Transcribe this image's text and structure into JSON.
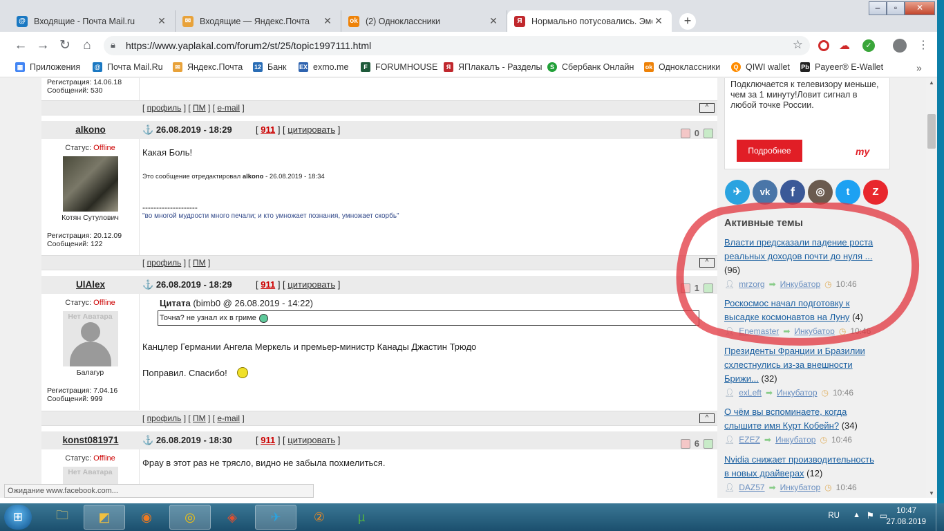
{
  "tabs": [
    {
      "title": "Входящие - Почта Mail.ru",
      "icon": "mailru-icon",
      "color": "#1a78c2",
      "glyph": "@"
    },
    {
      "title": "Входящие — Яндекс.Почта",
      "icon": "yandex-mail-icon",
      "color": "#e8a23a",
      "glyph": "✉"
    },
    {
      "title": "(2) Одноклассники",
      "icon": "ok-icon",
      "color": "#ee8208",
      "glyph": "ok"
    },
    {
      "title": "Нормально потусовались. Эмоц",
      "icon": "yaplakal-icon",
      "color": "#c0282d",
      "glyph": "Я"
    }
  ],
  "toolbar": {
    "url": "https://www.yaplakal.com/forum2/st/25/topic1997111.html"
  },
  "bookmarks": [
    {
      "label": "Приложения",
      "color": "#4285f4",
      "glyph": "▦"
    },
    {
      "label": "Почта Mail.Ru",
      "color": "#1a78c2",
      "glyph": "@"
    },
    {
      "label": "Яндекс.Почта",
      "color": "#e8a23a",
      "glyph": "✉"
    },
    {
      "label": "Банк",
      "color": "#2a6db5",
      "glyph": "12"
    },
    {
      "label": "exmo.me",
      "color": "#2f64b0",
      "glyph": "EX"
    },
    {
      "label": "FORUMHOUSE",
      "color": "#1e5a3a",
      "glyph": "F"
    },
    {
      "label": "ЯПлакалъ - Разделы",
      "color": "#c0282d",
      "glyph": "Я"
    },
    {
      "label": "Сбербанк Онлайн",
      "color": "#21a038",
      "glyph": "S"
    },
    {
      "label": "Одноклассники",
      "color": "#ee8208",
      "glyph": "ok"
    },
    {
      "label": "QIWI wallet",
      "color": "#ff8c00",
      "glyph": "Q"
    },
    {
      "label": "Payeer® E-Wallet",
      "color": "#222222",
      "glyph": "Pb"
    }
  ],
  "forum": {
    "top_reg": "Регистрация: 14.06.18",
    "top_msgs": "Сообщений: 530",
    "profile": "профиль",
    "pm": "ПМ",
    "email": "e-mail",
    "up": "[^]",
    "status_label": "Статус:",
    "offline": "Offline",
    "quote_word": "цитировать",
    "posts": [
      {
        "author": "alkono",
        "date": "26.08.2019 - 18:29",
        "rating": "911",
        "karma": "0",
        "nick": "Котян Сутулович",
        "reg": "Регистрация: 20.12.09",
        "msgs": "Сообщений: 122",
        "text": "Какая Боль!",
        "edit_prefix": "Это сообщение отредактировал",
        "edit_author": "alkono",
        "edit_date": " - 26.08.2019 - 18:34",
        "sig_line": "--------------------",
        "signature": "\"во многой мудрости много печали; и кто умножает познания, умножает скорбь\""
      },
      {
        "author": "UlAlex",
        "date": "26.08.2019 - 18:29",
        "rating": "911",
        "karma": "1",
        "no_avatar": "Нет Аватара",
        "nick": "Балагур",
        "reg": "Регистрация: 7.04.16",
        "msgs": "Сообщений: 999",
        "quote_label": "Цитата",
        "quote_src": "(bimb0 @ 26.08.2019 - 14:22)",
        "quote_text": "Точна? не узнал их в гриме",
        "text1": "Канцлер Германии Ангела Меркель и премьер-министр Канады Джастин Трюдо",
        "text2": "Поправил. Спасибо!"
      },
      {
        "author": "konst081971",
        "date": "26.08.2019 - 18:30",
        "rating": "911",
        "karma": "6",
        "no_avatar": "Нет Аватара",
        "text": "Фрау в этот раз не трясло, видно не забыла похмелиться."
      }
    ]
  },
  "ad": {
    "text": "Подключается к телевизору меньше, чем за 1 минуту!Ловит сигнал в любой точке России.",
    "button": "Подробнее",
    "brand": "my"
  },
  "social": [
    {
      "name": "telegram-icon",
      "color": "#2aa3e0",
      "glyph": "✈"
    },
    {
      "name": "vk-icon",
      "color": "#4a76a8",
      "glyph": "vk"
    },
    {
      "name": "facebook-icon",
      "color": "#3b5998",
      "glyph": "f"
    },
    {
      "name": "instagram-icon",
      "color": "#6b5b4f",
      "glyph": "◎"
    },
    {
      "name": "twitter-icon",
      "color": "#1da1f2",
      "glyph": "t"
    },
    {
      "name": "zen-icon",
      "color": "#e8272d",
      "glyph": "Z"
    }
  ],
  "active": {
    "title": "Активные темы",
    "topics": [
      {
        "l1": "Власти предсказали падение роста",
        "l2": "реальных доходов почти до нуля ...",
        "count": "(96)",
        "user": "mrzorg",
        "section": "Инкубатор",
        "time": "10:46"
      },
      {
        "l1": "Роскосмос начал подготовку к",
        "l2": "высадке космонавтов на Луну",
        "count": "(4)",
        "user": "Enemaster",
        "section": "Инкубатор",
        "time": "10:46"
      },
      {
        "l1": "Президенты Франции и Бразилии",
        "l2": "схлестнулись из-за внешности",
        "l3": "Брижи...",
        "count": "(32)",
        "user": "exLeft",
        "section": "Инкубатор",
        "time": "10:46"
      },
      {
        "l1": "О чём вы вспоминаете, когда",
        "l2": "слышите имя Курт Кобейн?",
        "count": "(34)",
        "user": "EZEZ",
        "section": "Инкубатор",
        "time": "10:46"
      },
      {
        "l1": "Nvidia снижает производительность",
        "l2": "в новых драйверах",
        "count": "(12)",
        "user": "DAZ57",
        "section": "Инкубатор",
        "time": "10:46"
      }
    ]
  },
  "status_bar": "Ожидание www.facebook.com...",
  "tray": {
    "lang": "RU",
    "time": "10:47",
    "date": "27.08.2019"
  }
}
